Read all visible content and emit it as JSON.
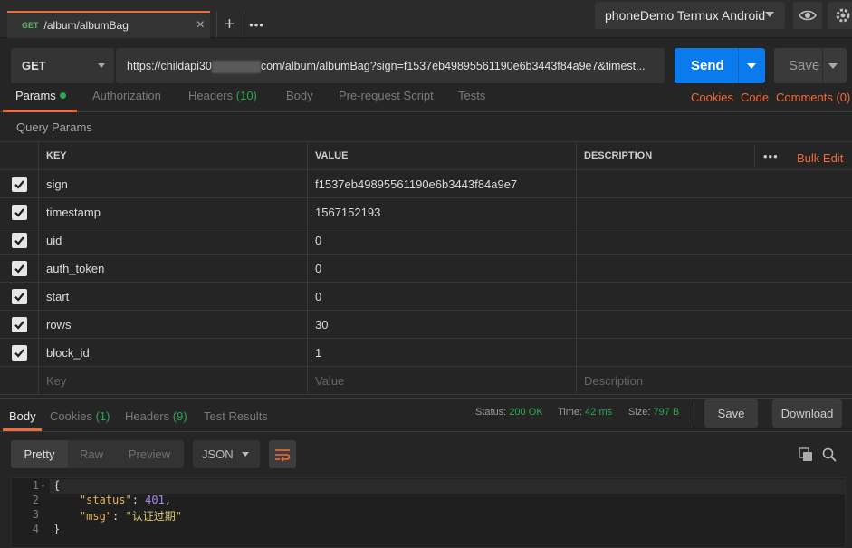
{
  "tab": {
    "method": "GET",
    "name": "/album/albumBag",
    "close": "×"
  },
  "toolbar": {
    "add": "+",
    "more": "•••"
  },
  "environment": {
    "selected": "phoneDemo Termux Android"
  },
  "request": {
    "method": "GET",
    "url_prefix": "https://childapi30",
    "url_suffix": "com/album/albumBag?sign=f1537eb49895561190e6b3443f84a9e7&timest...",
    "send_label": "Send",
    "save_label": "Save"
  },
  "request_tabs": {
    "params": "Params",
    "authorization": "Authorization",
    "headers": "Headers",
    "headers_count": "(10)",
    "body": "Body",
    "prerequest": "Pre-request Script",
    "tests": "Tests",
    "cookies": "Cookies",
    "code": "Code",
    "comments": "Comments (0)"
  },
  "query_params": {
    "title": "Query Params",
    "headers": {
      "key": "KEY",
      "value": "VALUE",
      "description": "DESCRIPTION"
    },
    "bulk_edit": "Bulk Edit",
    "more": "•••",
    "rows": [
      {
        "key": "sign",
        "value": "f1537eb49895561190e6b3443f84a9e7",
        "description": "",
        "checked": true
      },
      {
        "key": "timestamp",
        "value": "1567152193",
        "description": "",
        "checked": true
      },
      {
        "key": "uid",
        "value": "0",
        "description": "",
        "checked": true
      },
      {
        "key": "auth_token",
        "value": "0",
        "description": "",
        "checked": true
      },
      {
        "key": "start",
        "value": "0",
        "description": "",
        "checked": true
      },
      {
        "key": "rows",
        "value": "30",
        "description": "",
        "checked": true
      },
      {
        "key": "block_id",
        "value": "1",
        "description": "",
        "checked": true
      }
    ],
    "placeholder": {
      "key": "Key",
      "value": "Value",
      "description": "Description"
    }
  },
  "response": {
    "tabs": {
      "body": "Body",
      "cookies": "Cookies",
      "cookies_count": "(1)",
      "headers": "Headers",
      "headers_count": "(9)",
      "tests": "Test Results"
    },
    "status_label": "Status:",
    "status_value": "200 OK",
    "time_label": "Time:",
    "time_value": "42 ms",
    "size_label": "Size:",
    "size_value": "797 B",
    "save_label": "Save",
    "download_label": "Download",
    "view_modes": [
      "Pretty",
      "Raw",
      "Preview"
    ],
    "format": "JSON",
    "code_lines": [
      {
        "num": "1",
        "text": "{"
      },
      {
        "num": "2",
        "key": "\"status\"",
        "value": "401",
        "sep": ": ",
        "end": ","
      },
      {
        "num": "3",
        "key": "\"msg\"",
        "value": "\"认证过期\"",
        "sep": ": ",
        "end": ""
      },
      {
        "num": "4",
        "text": "}"
      }
    ]
  },
  "colors": {
    "accent": "#f26b3a",
    "send": "#097bed",
    "ok": "#2aa854",
    "number": "#a48ce8",
    "string": "#d9c875"
  }
}
